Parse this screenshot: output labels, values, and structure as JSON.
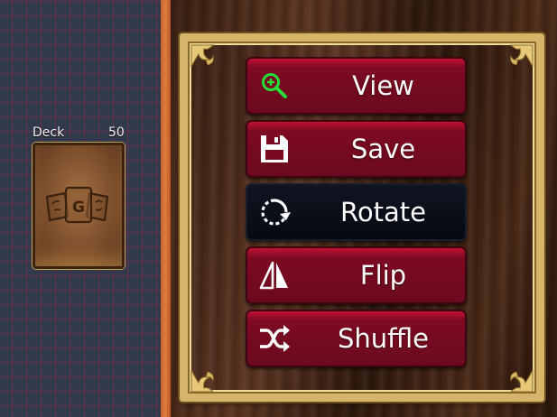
{
  "deck": {
    "name": "Deck",
    "count": "50",
    "card_back_icon": "game-logo-icon",
    "card_back_text": "G"
  },
  "menu": {
    "items": [
      {
        "label": "View",
        "icon": "zoom-in-icon",
        "icon_color": "#27e03a"
      },
      {
        "label": "Save",
        "icon": "floppy-disk-icon",
        "icon_color": "#ffffff"
      },
      {
        "label": "Rotate",
        "icon": "rotate-icon",
        "icon_color": "#ffffff",
        "highlighted": true
      },
      {
        "label": "Flip",
        "icon": "flip-icon",
        "icon_color": "#ffffff"
      },
      {
        "label": "Shuffle",
        "icon": "shuffle-icon",
        "icon_color": "#ffffff"
      }
    ]
  },
  "colors": {
    "button_red": "#b3102f",
    "button_highlight": "#060912",
    "frame_gold": "#d6b56a",
    "divider_orange": "#e27f3e"
  }
}
